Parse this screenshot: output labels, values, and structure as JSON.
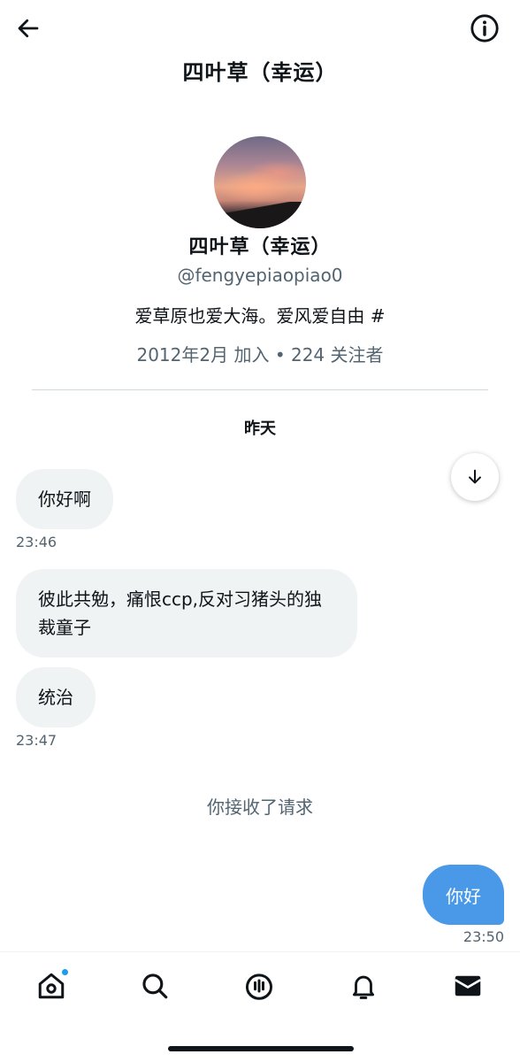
{
  "header": {
    "title": "四叶草（幸运）"
  },
  "profile": {
    "display_name": "四叶草（幸运）",
    "handle": "@fengyepiaopiao0",
    "bio": "爱草原也爱大海。爱风爱自由 #",
    "meta": "2012年2月 加入 • 224 关注者"
  },
  "conversation": {
    "date_separator": "昨天",
    "messages": [
      {
        "text": "你好啊",
        "direction": "received",
        "time": "23:46"
      },
      {
        "text": "彼此共勉，痛恨ccp,反对习猪头的独裁童子",
        "direction": "received",
        "time": ""
      },
      {
        "text": "统治",
        "direction": "received",
        "time": "23:47"
      }
    ],
    "system_note": "你接收了请求",
    "sent": {
      "text": "你好",
      "direction": "sent",
      "time": "23:50"
    }
  },
  "colors": {
    "accent": "#1d9bf0",
    "sent_bubble": "#4a99e9",
    "received_bubble": "#eff3f4",
    "secondary_text": "#536471"
  },
  "icons": {
    "back": "arrow-left-icon",
    "info": "info-circle-icon",
    "scroll": "arrow-down-icon",
    "tabs": [
      "home-icon",
      "search-icon",
      "spaces-icon",
      "notifications-icon",
      "messages-icon"
    ]
  }
}
